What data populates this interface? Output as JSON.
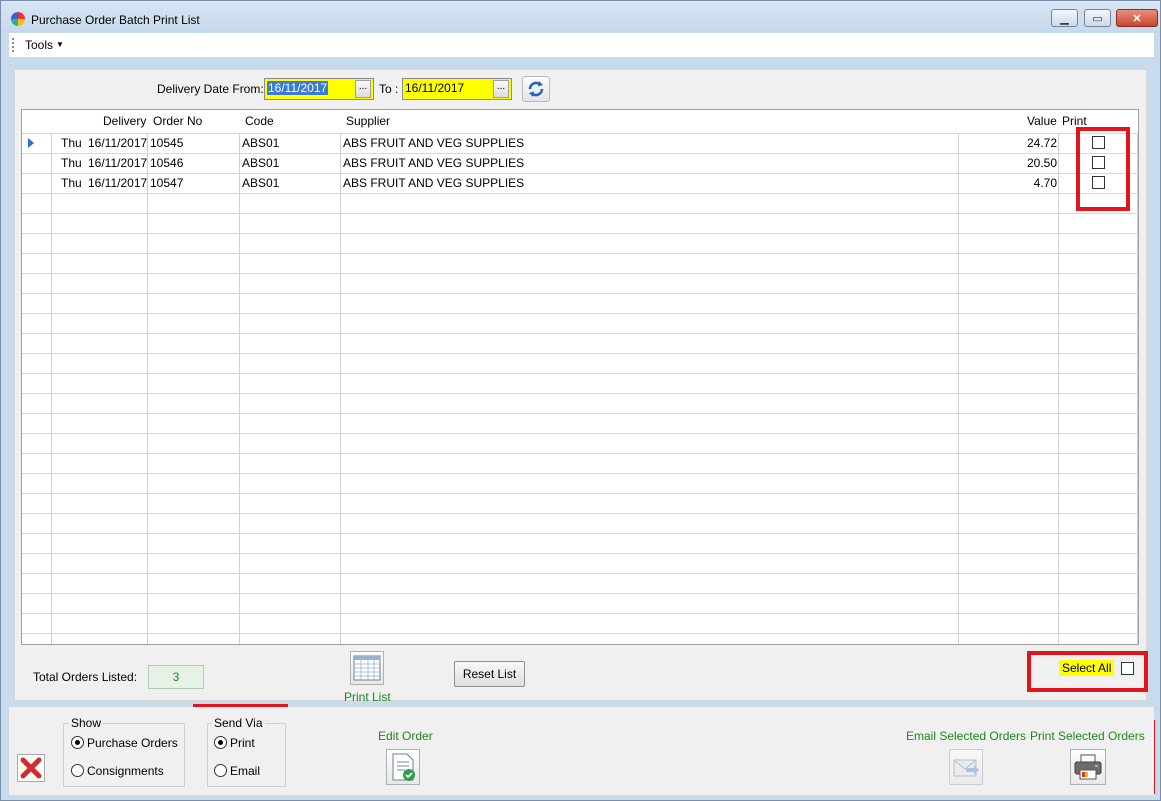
{
  "window": {
    "title": "Purchase Order Batch Print List",
    "minimize_glyph": "▁",
    "maximize_glyph": "▭",
    "close_glyph": "✕"
  },
  "menu": {
    "tools_label": "Tools"
  },
  "filters": {
    "from_label": "Delivery Date From:",
    "from_value": "16/11/2017",
    "to_label": "To :",
    "to_value": "16/11/2017",
    "picker_glyph": "..."
  },
  "grid": {
    "headers": {
      "delivery": "Delivery",
      "order_no": "Order No",
      "code": "Code",
      "supplier": "Supplier",
      "value": "Value",
      "print": "Print"
    },
    "rows": [
      {
        "day": "Thu",
        "date": "16/11/2017",
        "order_no": "10545",
        "code": "ABS01",
        "supplier": "ABS  FRUIT AND VEG SUPPLIES",
        "value": "24.72",
        "print": false
      },
      {
        "day": "Thu",
        "date": "16/11/2017",
        "order_no": "10546",
        "code": "ABS01",
        "supplier": "ABS  FRUIT AND VEG SUPPLIES",
        "value": "20.50",
        "print": false
      },
      {
        "day": "Thu",
        "date": "16/11/2017",
        "order_no": "10547",
        "code": "ABS01",
        "supplier": "ABS  FRUIT AND VEG SUPPLIES",
        "value": "4.70",
        "print": false
      }
    ]
  },
  "summary": {
    "total_label": "Total Orders Listed:",
    "total_value": "3",
    "print_list_label": "Print List",
    "reset_label": "Reset List",
    "select_all_label": "Select All"
  },
  "show_group": {
    "title": "Show",
    "options": [
      "Purchase Orders",
      "Consignments"
    ],
    "selected": "Purchase Orders"
  },
  "send_via_group": {
    "title": "Send Via",
    "options": [
      "Print",
      "Email"
    ],
    "selected": "Print"
  },
  "actions": {
    "edit_order": "Edit Order",
    "email_selected": "Email Selected Orders",
    "print_selected": "Print Selected Orders"
  },
  "colors": {
    "highlight_yellow": "#ffff00",
    "annotation_red": "#e3141c",
    "action_green": "#1b8a1b",
    "selection_blue": "#3a7bd5"
  }
}
